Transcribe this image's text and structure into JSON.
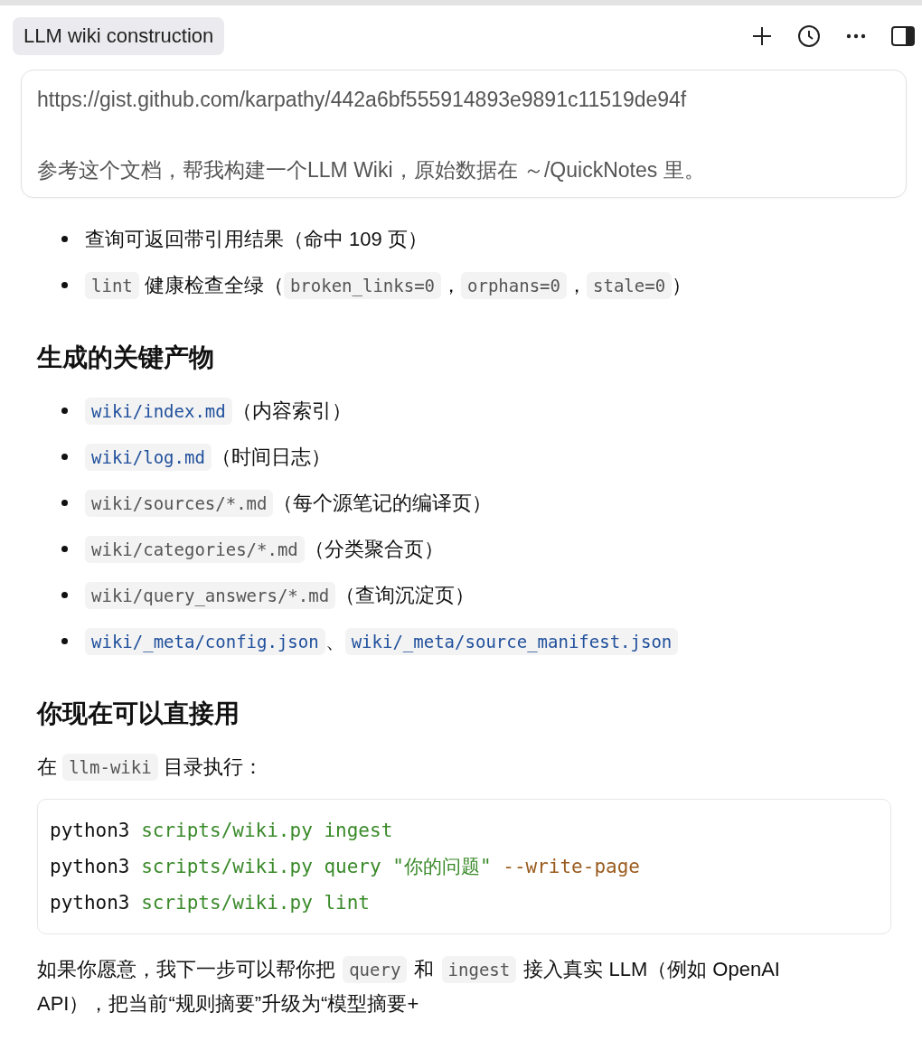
{
  "header": {
    "title": "LLM wiki construction"
  },
  "prompt": {
    "lines": [
      "https://gist.github.com/karpathy/442a6bf555914893e9891c11519de94f",
      "参考这个文档，帮我构建一个LLM Wiki，原始数据在 ～/QuickNotes 里。"
    ]
  },
  "results": [
    [
      {
        "kind": "text",
        "text": "查询可返回带引用结果（命中 109 页）"
      }
    ],
    [
      {
        "kind": "code",
        "text": "lint"
      },
      {
        "kind": "text",
        "text": " 健康检查全绿（"
      },
      {
        "kind": "code",
        "text": "broken_links=0"
      },
      {
        "kind": "text",
        "text": "，"
      },
      {
        "kind": "code",
        "text": "orphans=0"
      },
      {
        "kind": "text",
        "text": "，"
      },
      {
        "kind": "code",
        "text": "stale=0"
      },
      {
        "kind": "text",
        "text": "）"
      }
    ]
  ],
  "artifacts_heading": "生成的关键产物",
  "artifacts": [
    [
      {
        "kind": "link",
        "text": "wiki/index.md"
      },
      {
        "kind": "text",
        "text": "（内容索引）"
      }
    ],
    [
      {
        "kind": "link",
        "text": "wiki/log.md"
      },
      {
        "kind": "text",
        "text": "（时间日志）"
      }
    ],
    [
      {
        "kind": "code",
        "text": "wiki/sources/*.md"
      },
      {
        "kind": "text",
        "text": "（每个源笔记的编译页）"
      }
    ],
    [
      {
        "kind": "code",
        "text": "wiki/categories/*.md"
      },
      {
        "kind": "text",
        "text": "（分类聚合页）"
      }
    ],
    [
      {
        "kind": "code",
        "text": "wiki/query_answers/*.md"
      },
      {
        "kind": "text",
        "text": "（查询沉淀页）"
      }
    ],
    [
      {
        "kind": "link",
        "text": "wiki/_meta/config.json"
      },
      {
        "kind": "text",
        "text": "、"
      },
      {
        "kind": "link",
        "text": "wiki/_meta/source_manifest.json"
      }
    ]
  ],
  "usage_heading": "你现在可以直接用",
  "usage_intro": [
    {
      "kind": "text",
      "text": "在 "
    },
    {
      "kind": "code",
      "text": "llm-wiki"
    },
    {
      "kind": "text",
      "text": " 目录执行："
    }
  ],
  "code_block": [
    [
      {
        "kind": "plain",
        "text": "python3 "
      },
      {
        "kind": "green",
        "text": "scripts/wiki.py ingest"
      }
    ],
    [
      {
        "kind": "plain",
        "text": "python3 "
      },
      {
        "kind": "green",
        "text": "scripts/wiki.py query "
      },
      {
        "kind": "string",
        "text": "\"你的问题\""
      },
      {
        "kind": "flag",
        "text": " --write-page"
      }
    ],
    [
      {
        "kind": "plain",
        "text": "python3 "
      },
      {
        "kind": "green",
        "text": "scripts/wiki.py lint"
      }
    ]
  ],
  "closing": [
    {
      "kind": "text",
      "text": "如果你愿意，我下一步可以帮你把 "
    },
    {
      "kind": "code",
      "text": "query"
    },
    {
      "kind": "text",
      "text": " 和 "
    },
    {
      "kind": "code",
      "text": "ingest"
    },
    {
      "kind": "text",
      "text": " 接入真实 LLM（例如 OpenAI API），把当前“规则摘要”升级为“模型摘要+"
    }
  ]
}
